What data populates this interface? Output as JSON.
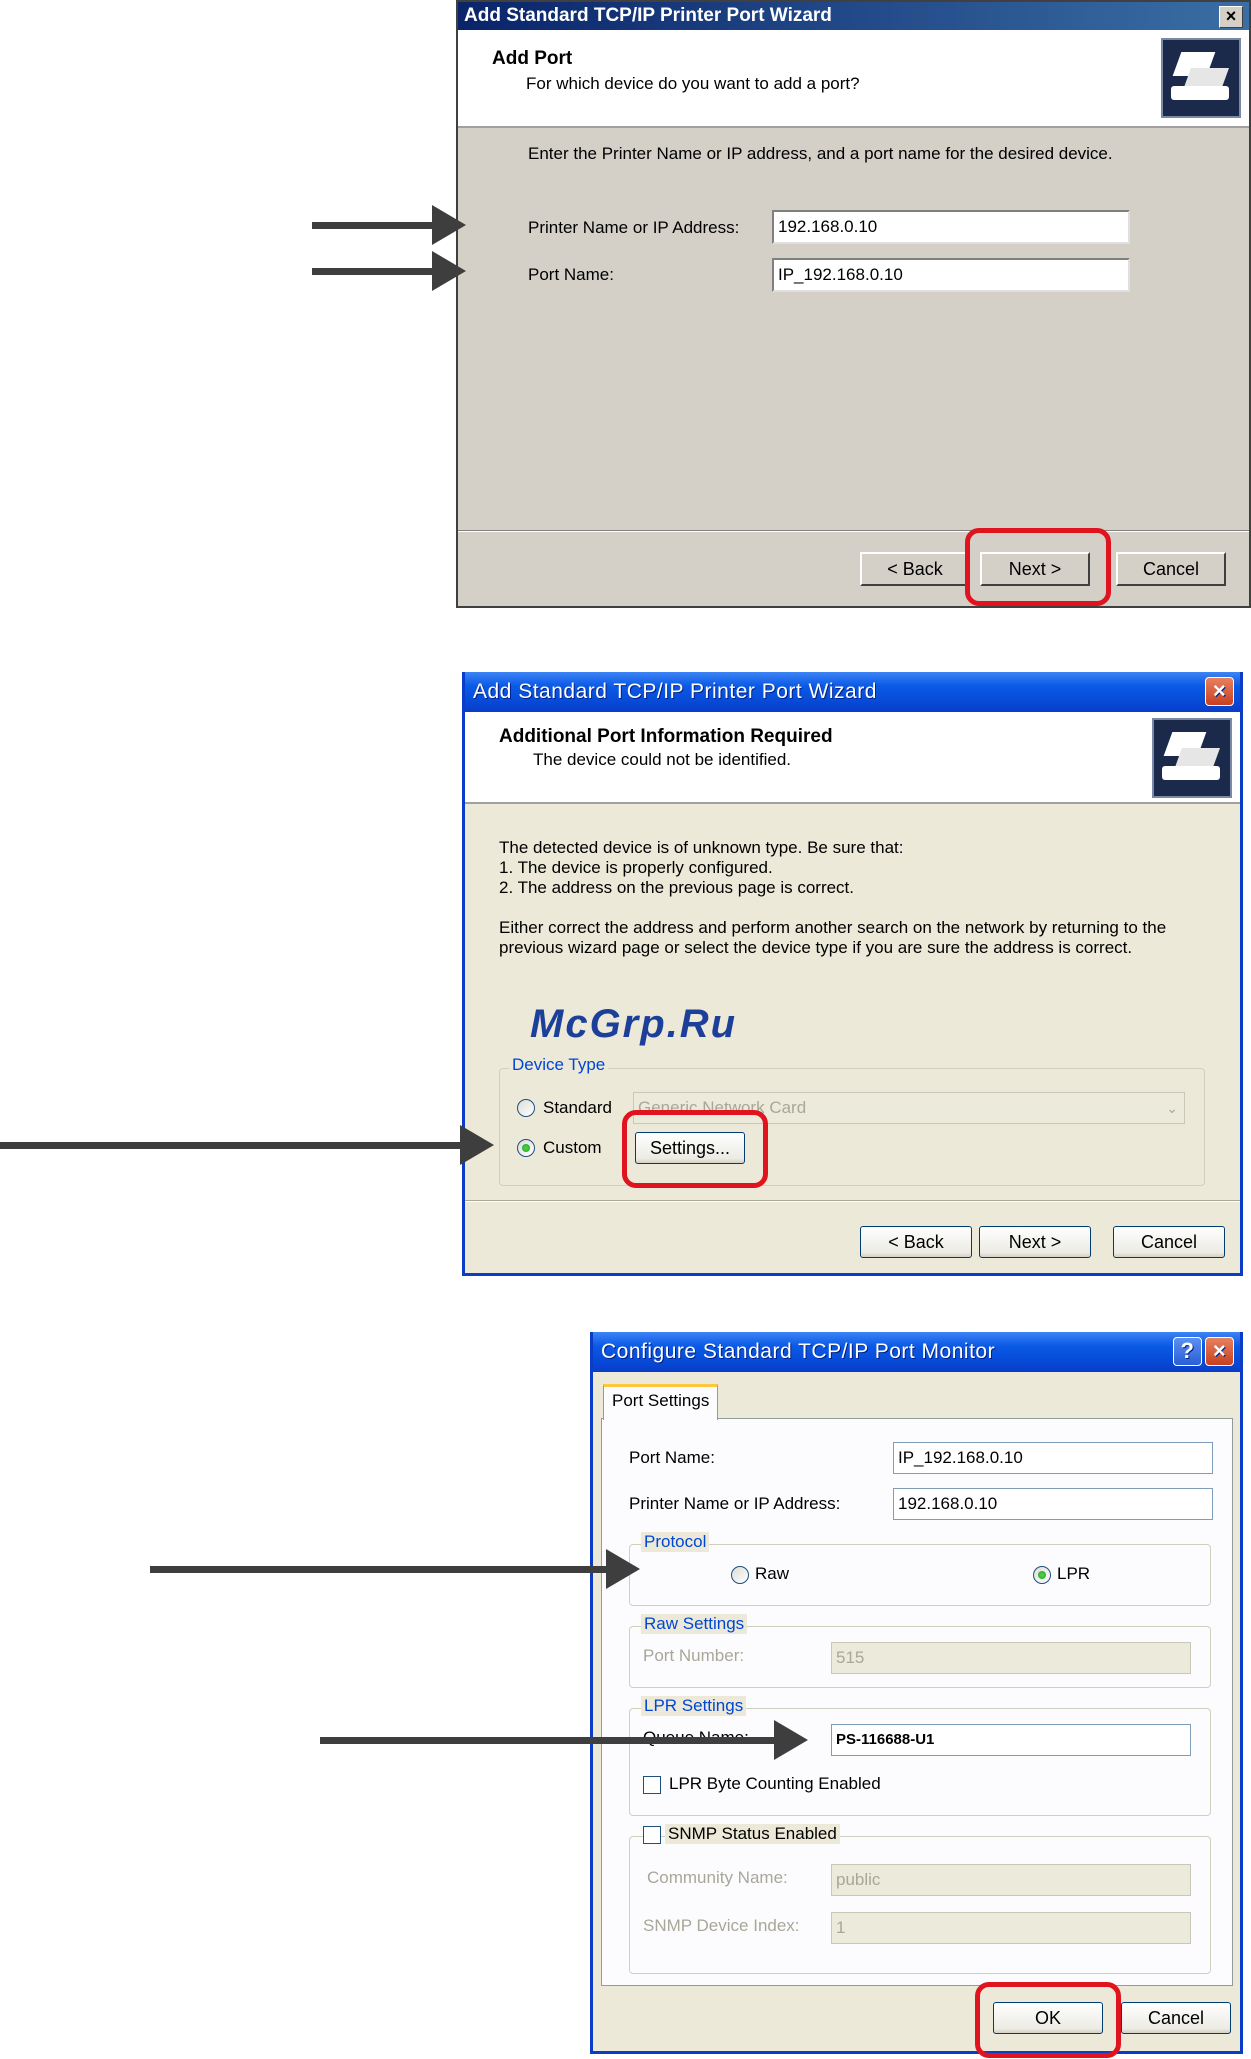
{
  "wizard1": {
    "title": "Add Standard TCP/IP Printer Port Wizard",
    "close": "×",
    "heading": "Add Port",
    "subheading": "For which device do you want to add a port?",
    "instruction": "Enter the Printer Name or IP address, and a port name for the desired device.",
    "printer_label": "Printer Name or IP Address:",
    "printer_value": "192.168.0.10",
    "port_label": "Port Name:",
    "port_value": "IP_192.168.0.10",
    "back": "< Back",
    "next": "Next >",
    "cancel": "Cancel"
  },
  "wizard2": {
    "title": "Add Standard TCP/IP Printer Port Wizard",
    "close": "×",
    "heading": "Additional Port Information Required",
    "subheading": "The device could not be identified.",
    "line1": "The detected device is of unknown type.  Be sure that:",
    "line2": "1. The device is properly configured.",
    "line3": "2.  The address on the previous page is correct.",
    "line4": "Either correct the address and perform another search on the network by returning to the",
    "line5": "previous wizard page or select the device type if you are sure the address is correct.",
    "device_type": "Device Type",
    "standard": "Standard",
    "standard_value": "Generic Network Card",
    "custom": "Custom",
    "settings": "Settings...",
    "back": "< Back",
    "next": "Next >",
    "cancel": "Cancel"
  },
  "monitor": {
    "title": "Configure Standard TCP/IP Port Monitor",
    "help": "?",
    "close": "×",
    "tab": "Port Settings",
    "port_label": "Port Name:",
    "port_value": "IP_192.168.0.10",
    "printer_label": "Printer Name or IP Address:",
    "printer_value": "192.168.0.10",
    "protocol": "Protocol",
    "raw": "Raw",
    "lpr": "LPR",
    "raw_settings": "Raw Settings",
    "port_number_label": "Port Number:",
    "port_number_value": "515",
    "lpr_settings": "LPR Settings",
    "queue_label": "Queue Name:",
    "queue_value": "PS-116688-U1",
    "lpr_byte": "LPR Byte Counting Enabled",
    "snmp": "SNMP Status Enabled",
    "community_label": "Community Name:",
    "community_value": "public",
    "snmp_index_label": "SNMP Device Index:",
    "snmp_index_value": "1",
    "ok": "OK",
    "cancel": "Cancel"
  },
  "watermark": "McGrp.Ru",
  "colors": {
    "highlight": "#e0141e",
    "arrow": "#3e3e3e",
    "xp_title": "#0a5ae6"
  }
}
